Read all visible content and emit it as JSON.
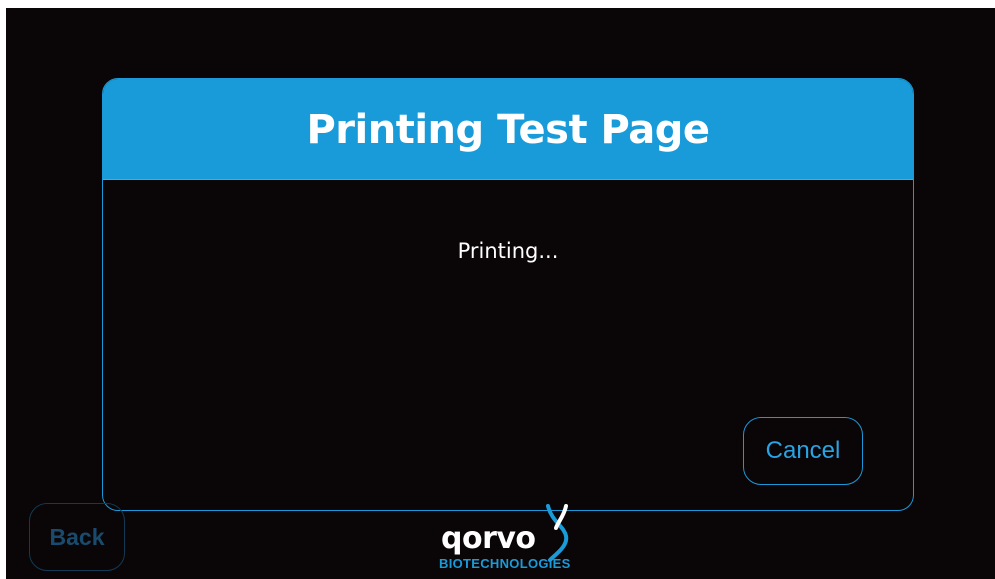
{
  "dialog": {
    "title": "Printing Test Page",
    "message": "Printing...",
    "cancel_label": "Cancel"
  },
  "nav": {
    "back_label": "Back"
  },
  "branding": {
    "logo_word": "qorvo",
    "logo_subtitle": "BIOTECHNOLOGIES",
    "logo_icon": "dna-helix-icon"
  },
  "colors": {
    "accent": "#1a9bd9",
    "background": "#0a0506",
    "text": "#ffffff",
    "disabled": "#184b6d"
  }
}
